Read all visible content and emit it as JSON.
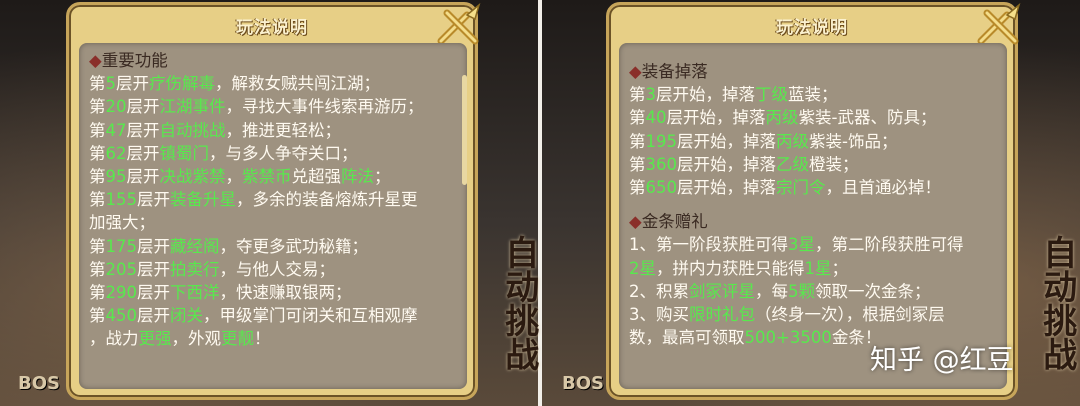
{
  "left_panel": {
    "title": "玩法说明",
    "section_title": "重要功能",
    "lines": [
      {
        "pre": "第",
        "num": "5",
        "mid": "层开",
        "feat": "疗伤解毒",
        "post": "，解救女贼共闯江湖；"
      },
      {
        "pre": "第",
        "num": "20",
        "mid": "层开",
        "feat": "江湖事件",
        "post": "，寻找大事件线索再游历；"
      },
      {
        "pre": "第",
        "num": "47",
        "mid": "层开",
        "feat": "自动挑战",
        "post": "，推进更轻松；"
      },
      {
        "pre": "第",
        "num": "62",
        "mid": "层开",
        "feat": "镇蜀门",
        "post": "，与多人争夺关口；"
      },
      {
        "pre": "第",
        "num": "95",
        "mid": "层开",
        "feat": "决战紫禁",
        "post": "，",
        "extra_hl": "紫禁币",
        "extra_post": "兑超强",
        "extra_hl2": "阵法",
        "extra_post2": "；"
      },
      {
        "pre": "第",
        "num": "155",
        "mid": "层开",
        "feat": "装备升星",
        "post": "，多余的装备熔炼升星更"
      },
      {
        "plain": "加强大；"
      },
      {
        "pre": "第",
        "num": "175",
        "mid": "层开",
        "feat": "藏经阁",
        "post": "，夺更多武功秘籍；"
      },
      {
        "pre": "第",
        "num": "205",
        "mid": "层开",
        "feat": "拍卖行",
        "post": "，与他人交易；"
      },
      {
        "pre": "第",
        "num": "290",
        "mid": "层开",
        "feat": "下西洋",
        "post": "，快速赚取银两；"
      },
      {
        "pre": "第",
        "num": "450",
        "mid": "层开",
        "feat": "闭关",
        "post": "，甲级掌门可闭关和互相观摩"
      },
      {
        "pre": "，战力",
        "num": "更强",
        "mid": "，外观",
        "feat": "更靓",
        "post": "！"
      }
    ]
  },
  "right_panel": {
    "title": "玩法说明",
    "drop_section_title": "装备掉落",
    "drop_lines": [
      {
        "pre": "第",
        "num": "3",
        "mid": "层开始，掉落",
        "feat": "丁级",
        "post": "蓝装；"
      },
      {
        "pre": "第",
        "num": "40",
        "mid": "层开始，掉落",
        "feat": "丙级",
        "post": "紫装-武器、防具；"
      },
      {
        "pre": "第",
        "num": "195",
        "mid": "层开始，掉落",
        "feat": "丙级",
        "post": "紫装-饰品；"
      },
      {
        "pre": "第",
        "num": "360",
        "mid": "层开始，掉落",
        "feat": "乙级",
        "post": "橙装；"
      },
      {
        "pre": "第",
        "num": "650",
        "mid": "层开始，掉落",
        "feat": "宗门令",
        "post": "，且首通必掉！"
      }
    ],
    "gold_section_title": "金条赠礼",
    "gold_lines": [
      {
        "pre": "1、第一阶段获胜可得",
        "num": "3星",
        "mid": "，第二阶段获胜可得",
        "feat": "",
        "post": ""
      },
      {
        "pre": "",
        "num": "2星",
        "mid": "，拼内力获胜只能得",
        "feat": "1星",
        "post": "；"
      },
      {
        "pre": "2、积累",
        "num": "剑冢评星",
        "mid": "，每",
        "feat": "5颗",
        "post": "领取一次金条；"
      },
      {
        "pre": "3、购买",
        "num": "限时礼包",
        "mid": "（终身一次），根据剑冢层",
        "feat": "",
        "post": ""
      },
      {
        "pre": "数，最高可领取",
        "num": "500+3500",
        "mid": "金条！",
        "feat": "",
        "post": ""
      }
    ]
  },
  "background": {
    "left_boss_label": "BOS",
    "right_boss_label": "BOS",
    "left_tag": "自动挑战",
    "right_tag": "自动挑战"
  },
  "watermark": "知乎 @红豆",
  "colors": {
    "highlight": "#58e94d",
    "panel_frame": "#e7cf86",
    "content_bg": "#9e9280",
    "title_text": "#fbf1cf"
  }
}
